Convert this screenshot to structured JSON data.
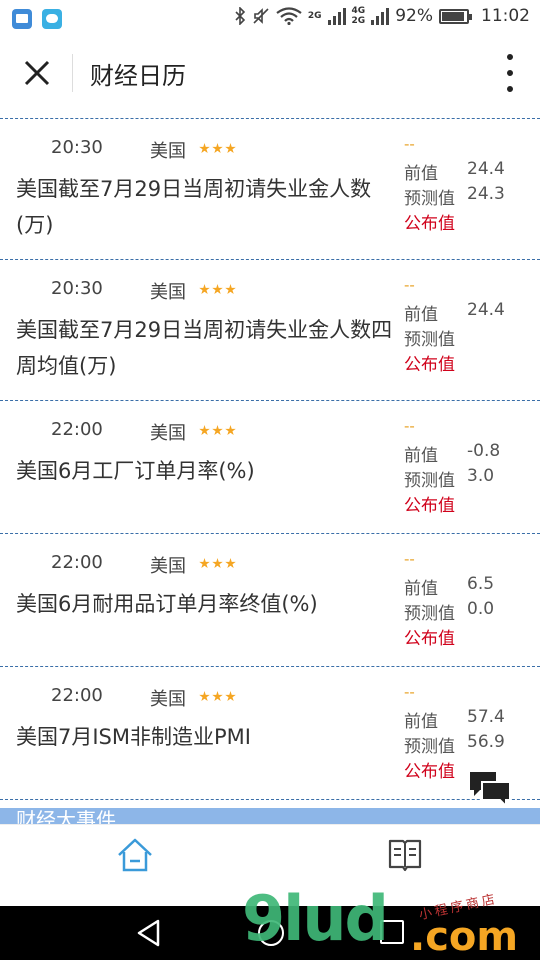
{
  "status_bar": {
    "network_1": "2G",
    "network_2": "4G",
    "network_3": "2G",
    "battery": "92%",
    "battery_level": 0.92,
    "time": "11:02"
  },
  "header": {
    "title": "财经日历"
  },
  "labels": {
    "previous": "前值",
    "forecast": "预测值",
    "published": "公布值"
  },
  "events": [
    {
      "time": "20:30",
      "country": "美国",
      "stars": 3,
      "name": "美国截至7月29日当周初请失业金人数(万)",
      "status": "--",
      "previous": "24.4",
      "forecast": "24.3",
      "published": ""
    },
    {
      "time": "20:30",
      "country": "美国",
      "stars": 3,
      "name": "美国截至7月29日当周初请失业金人数四周均值(万)",
      "status": "--",
      "previous": "24.4",
      "forecast": "",
      "published": ""
    },
    {
      "time": "22:00",
      "country": "美国",
      "stars": 3,
      "name": "美国6月工厂订单月率(%)",
      "status": "--",
      "previous": "-0.8",
      "forecast": "3.0",
      "published": ""
    },
    {
      "time": "22:00",
      "country": "美国",
      "stars": 3,
      "name": "美国6月耐用品订单月率终值(%)",
      "status": "--",
      "previous": "6.5",
      "forecast": "0.0",
      "published": ""
    },
    {
      "time": "22:00",
      "country": "美国",
      "stars": 3,
      "name": "美国7月ISM非制造业PMI",
      "status": "--",
      "previous": "57.4",
      "forecast": "56.9",
      "published": ""
    }
  ],
  "section_strip": "财经大事件",
  "watermark": {
    "main": "9lud",
    "suffix": ".com",
    "tag": "小程序商店"
  },
  "icons": {
    "close": "close-icon",
    "more": "more-vertical-icon",
    "chat": "chat-bubbles-icon",
    "home": "home-icon",
    "news": "book-icon"
  },
  "colors": {
    "accent_blue": "#3a6ea8",
    "star": "#f5a623",
    "published_red": "#d0021b",
    "status_orange": "#e8a32a",
    "tab_active": "#3a9ad9"
  }
}
